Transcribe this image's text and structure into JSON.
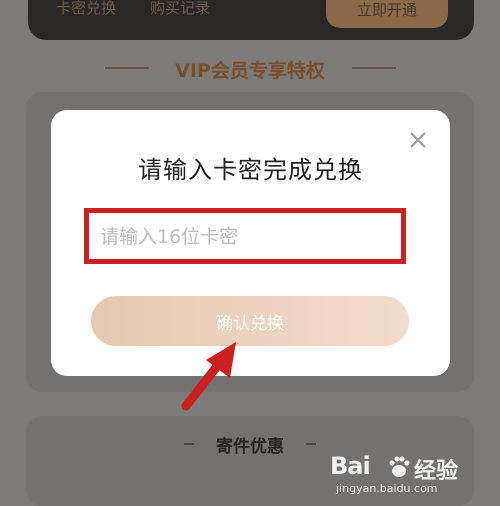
{
  "background": {
    "tabs": [
      "卡密兑换",
      "购买记录"
    ],
    "open_button": "立即开通",
    "section_title": "VIP会员专享特权",
    "section2_title": "寄件优惠"
  },
  "dialog": {
    "title": "请输入卡密完成兑换",
    "input_placeholder": "请输入16位卡密",
    "input_value": "",
    "confirm_label": "确认兑换",
    "close_icon": "close-icon"
  },
  "annotation": {
    "highlight_color": "#cc1f1f",
    "arrow_color": "#cc1f1f"
  },
  "watermark": {
    "logo": "Bai",
    "brand": "经验",
    "url": "jingyan.baidu.com"
  },
  "colors": {
    "overlay_bg": "#7d7b78",
    "confirm_gradient_start": "#e6c8b3",
    "confirm_gradient_end": "#f3dccd"
  }
}
